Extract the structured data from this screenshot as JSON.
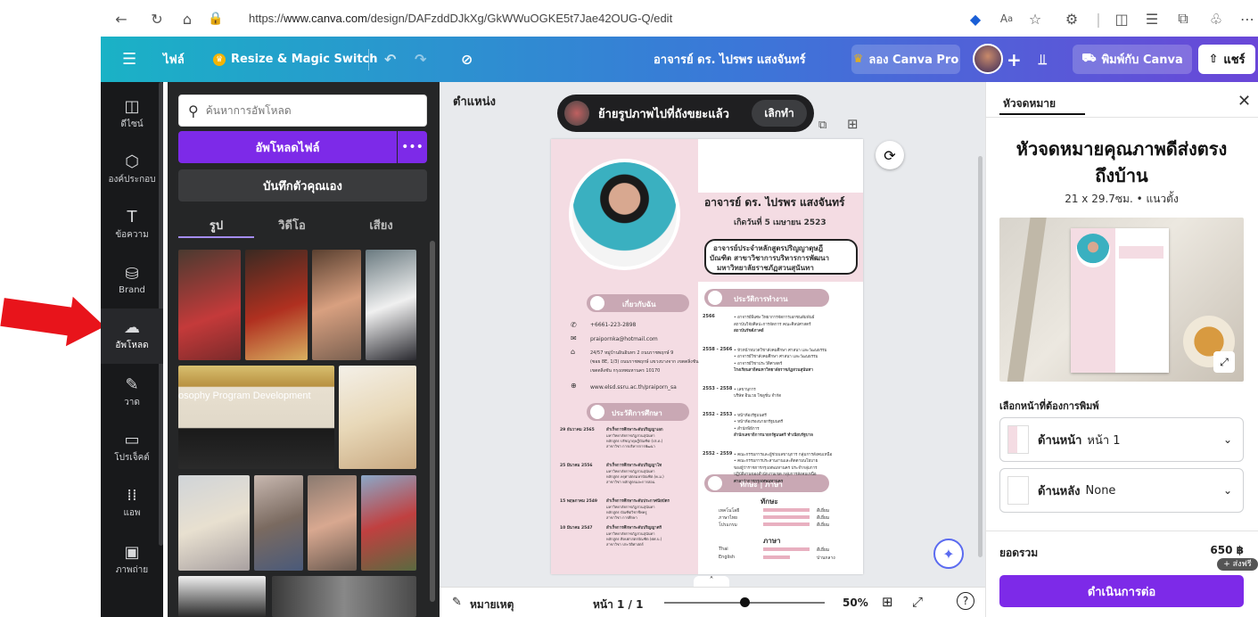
{
  "browser": {
    "url_prefix": "https://",
    "url_domain": "www.canva.com",
    "url_path": "/design/DAFzddDJkXg/GkWWuOGKE5t7Jae42OUG-Q/edit"
  },
  "header": {
    "file_label": "ไฟล์",
    "resize_label": "Resize & Magic Switch",
    "design_title": "อาจารย์ ดร. ไปรพร แสงจันทร์",
    "try_pro_label": "ลอง Canva Pro",
    "print_label": "พิมพ์กับ Canva",
    "share_label": "แชร์"
  },
  "rail": {
    "items": [
      {
        "label": "ดีไซน์",
        "icon": "layout-icon"
      },
      {
        "label": "องค์ประกอบ",
        "icon": "shapes-icon"
      },
      {
        "label": "ข้อความ",
        "icon": "text-icon"
      },
      {
        "label": "Brand",
        "icon": "brand-icon"
      },
      {
        "label": "อัพโหลด",
        "icon": "cloud-upload-icon"
      },
      {
        "label": "วาด",
        "icon": "draw-icon"
      },
      {
        "label": "โปรเจ็คต์",
        "icon": "folder-icon"
      },
      {
        "label": "แอพ",
        "icon": "apps-icon"
      },
      {
        "label": "ภาพถ่าย",
        "icon": "photo-icon"
      }
    ]
  },
  "panel": {
    "search_placeholder": "ค้นหาการอัพโหลด",
    "upload_button": "อัพโหลดไฟล์",
    "record_button": "บันทึกตัวคุณเอง",
    "tabs": [
      "รูป",
      "วิดีโอ",
      "เสียง"
    ],
    "thumb_caption": "osophy Program Development"
  },
  "canvas": {
    "position_label": "ตำแหน่ง",
    "toast_text": "ย้ายรูปภาพไปที่ถังขยะแล้ว",
    "toast_undo": "เลิกทำ",
    "notes_label": "หมายเหตุ",
    "page_indicator": "หน้า 1 / 1",
    "zoom": "50%",
    "zoom_fraction": 0.5
  },
  "resume": {
    "name": "อาจารย์ ดร. ไปรพร แสงจันทร์",
    "birth": "เกิดวันที่ 5 เมษายน 2523",
    "position_lines": [
      "อาจารย์ประจำหลักสูตรปริญญาดุษฎี",
      "บัณฑิต สาขาวิชาการบริหารการพัฒนา",
      "มหาวิทยาลัยราชภัฏสวนสุนันทา"
    ],
    "about_heading": "เกี่ยวกับฉัน",
    "phone": "+6661-223-2898",
    "email": "praipornka@hotmail.com",
    "address_lines": [
      "24/57 หมู่บ้านอินอินทร 2 ถนนราชพฤกษ์ 9",
      "(ซอย 8E, 1/3) ถนนราชพฤกษ์ แขวงบางจาก เขตตลิ่งชัน",
      "เขตตลิ่งชัน กรุงเทพมหานคร 10170"
    ],
    "website": "www.elsd.ssru.ac.th/praiporn_sa",
    "work_heading": "ประวัติการทำงาน",
    "work": [
      {
        "year": "2566",
        "lines": [
          "• อาจารย์พิเศษ วิทยาการจัดการเอกชนสัมพันธ์",
          "สถาบันวิจัยศิลปะการจัดการ คณะศิลปศาสตร์",
          "สถาบันรัชต์ภาคย์"
        ]
      },
      {
        "year": "2558 - 2566",
        "lines": [
          "• หัวหน้าหมวดวิชาสังคมศึกษา ศาสนา และวัฒนธรรม",
          "• อาจารย์วิชาสังคมศึกษา ศาสนา และวัฒนธรรม",
          "• อาจารย์วิชาประวัติศาสตร์",
          "โรงเรียนสาธิตมหาวิทยาลัยราชภัฏสวนสุนันทา"
        ]
      },
      {
        "year": "2553 - 2558",
        "lines": [
          "• เลขานุการ",
          "บริษัท อินเวย โซลูชั่น จำกัด"
        ]
      },
      {
        "year": "2552 - 2553",
        "lines": [
          "• หน้าห้องรัฐมนตรี",
          "• หน้าห้องรองนายกรัฐมนตรี",
          "• สำนักพิธีการ",
          "สำนักเลขาธิการนายกรัฐมนตรี ทำเนียบรัฐบาล"
        ]
      },
      {
        "year": "2552 - 2559",
        "lines": [
          "• คณะกรรมการและผู้ช่วยเลขานุการ กลุ่มการสังคมเหนือ",
          "• คณะกรรมการประสานงานและติดตามนโยบาย",
          "ของผู้ว่าราชการกรุงเทพมหานคร ประจำกลุ่มการ",
          "ปฏิบัติงานของสำนักงานเขต กลุ่มการสังคมเหนือ",
          "ศาลาว่าการกรุงเทพมหานคร"
        ]
      }
    ],
    "edu_heading": "ประวัติการศึกษา",
    "edu": [
      {
        "date": "29 ธันวาคม 2565",
        "title": "สำเร็จการศึกษาระดับปริญญาเอก",
        "lines": [
          "มหาวิทยาลัยราชภัฏสวนสุนันทา",
          "หลักสูตร ปรัชญาดุษฎีบัณฑิต (ปร.ด.)",
          "สาขาวิชา การบริหารการพัฒนา"
        ]
      },
      {
        "date": "25 มีนาคม 2556",
        "title": "สำเร็จการศึกษาระดับปริญญาโท",
        "lines": [
          "มหาวิทยาลัยราชภัฏสวนสุนันทา",
          "หลักสูตร ครุศาสตรมหาบัณฑิต (ค.ม.)",
          "สาขาวิชา หลักสูตรและการสอน"
        ]
      },
      {
        "date": "15 พฤษภาคม 2549",
        "title": "สำเร็จการศึกษาระดับประกาศนียบัตร",
        "lines": [
          "มหาวิทยาลัยราชภัฏสวนสุนันทา",
          "หลักสูตร บัณฑิตวิชาชีพครู",
          "สาขาวิชา การศึกษา"
        ]
      },
      {
        "date": "10 มีนาคม 2547",
        "title": "สำเร็จการศึกษาระดับปริญญาตรี",
        "lines": [
          "มหาวิทยาลัยราชภัฏสวนสุนันทา",
          "หลักสูตร ศิลปศาสตรบัณฑิต (ศศ.บ.)",
          "สาขาวิชา ประวัติศาสตร์"
        ]
      }
    ],
    "skills_heading": "ทักษะ | ภาษา",
    "skills_sub": "ทักษะ",
    "skills": [
      {
        "name": "เทคโนโลยี",
        "level": "ดีเยี่ยม"
      },
      {
        "name": "ภาษาไทย",
        "level": "ดีเยี่ยม"
      },
      {
        "name": "โปรแกรม",
        "level": "ดีเยี่ยม"
      }
    ],
    "lang_sub": "ภาษา",
    "langs": [
      {
        "name": "Thai",
        "level": "ดีเยี่ยม"
      },
      {
        "name": "English",
        "level": "ปานกลาง"
      }
    ]
  },
  "right_panel": {
    "tab": "หัวจดหมาย",
    "title_line1": "หัวจดหมายคุณภาพดีส่งตรง",
    "title_line2": "ถึงบ้าน",
    "spec": "21 x 29.7ซม. • แนวตั้ง",
    "choose_label": "เลือกหน้าที่ต้องการพิมพ์",
    "front_label": "ด้านหน้า",
    "front_value": "หน้า 1",
    "back_label": "ด้านหลัง",
    "back_value": "None",
    "total_label": "ยอดรวม",
    "price": "650 ฿",
    "free_ship": "+ ส่งฟรี",
    "continue_button": "ดำเนินการต่อ"
  },
  "colors": {
    "accent": "#7d2ae8",
    "resume_pink": "#f4dce3",
    "arrow_red": "#e8141b"
  }
}
